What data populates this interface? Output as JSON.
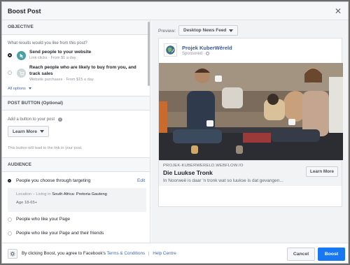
{
  "dialog": {
    "title": "Boost Post",
    "close": "✕"
  },
  "objective": {
    "header": "OBJECTIVE",
    "question": "What results would you like from this post?",
    "options": [
      {
        "title": "Send people to your website",
        "subtitle": "Link clicks · From $1 a day"
      },
      {
        "title": "Reach people who are likely to buy from you, and track sales",
        "subtitle": "Website purchases · From $15 a day"
      }
    ],
    "all_options": "All options"
  },
  "post_button": {
    "header": "POST BUTTON (Optional)",
    "label": "Add a button to your post",
    "value": "Learn More",
    "note": "This button will lead to the link in your post."
  },
  "audience": {
    "header": "AUDIENCE",
    "options": [
      {
        "label": "People you choose through targeting",
        "edit": "Edit"
      },
      {
        "label": "People who like your Page"
      },
      {
        "label": "People who like your Page and their friends"
      }
    ],
    "location_prefix": "Location – Living in",
    "location_value": "South Africa: Pretoria Gauteng",
    "age": "Age 18-65+"
  },
  "preview": {
    "label": "Preview:",
    "placement": "Desktop News Feed",
    "page_name": "Projek KuberWêreld",
    "sponsored": "Sponsored ·",
    "domain": "PROJEK-KUBERWERELD.WEBFLOW.IO",
    "headline": "Die Luukse Tronk",
    "description": "In Noorweë is daar 'n tronk wat so luukse is dat gevangen...",
    "cta": "Learn More"
  },
  "footer": {
    "terms_prefix": "By clicking Boost, you agree to Facebook's",
    "terms_link": "Terms & Conditions",
    "separator": "|",
    "help_link": "Help Centre",
    "cancel": "Cancel",
    "boost": "Boost"
  },
  "colors": {
    "accent": "#1877f2",
    "link": "#4267b2",
    "objective_icon": "#4aa1a3"
  }
}
